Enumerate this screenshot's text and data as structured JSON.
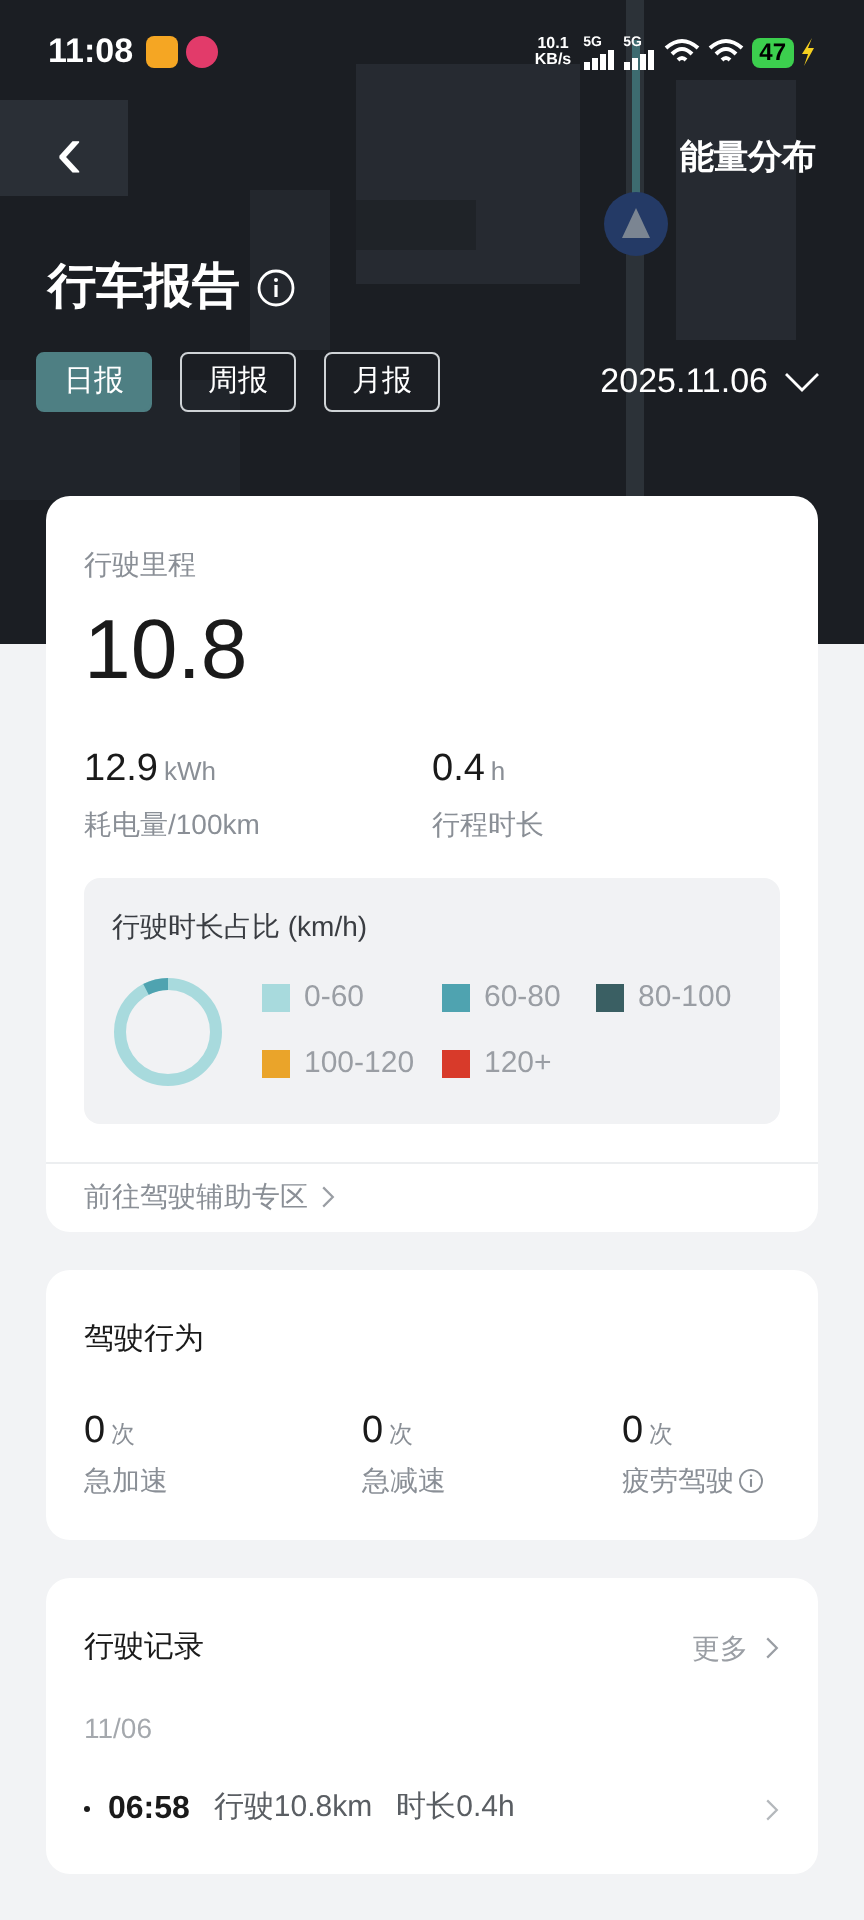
{
  "status_bar": {
    "time": "11:08",
    "net_speed": "10.1",
    "net_unit": "KB/s",
    "signals": [
      "5G",
      "5G"
    ],
    "battery": "47"
  },
  "header": {
    "back": "‹",
    "action": "能量分布",
    "title": "行车报告",
    "tabs": [
      {
        "label": "日报",
        "selected": true
      },
      {
        "label": "周报",
        "selected": false
      },
      {
        "label": "月报",
        "selected": false
      }
    ],
    "date": "2025.11.06"
  },
  "summary": {
    "label": "行驶里程",
    "distance": "10.8",
    "stats": [
      {
        "value": "12.9",
        "unit": "kWh",
        "label": "耗电量/100km"
      },
      {
        "value": "0.4",
        "unit": "h",
        "label": "行程时长"
      }
    ],
    "speed_share": {
      "title": "行驶时长占比 (km/h)",
      "legend": [
        {
          "label": "0-60",
          "color": "#a8dadd"
        },
        {
          "label": "60-80",
          "color": "#4fa3b0"
        },
        {
          "label": "80-100",
          "color": "#3a5f63"
        },
        {
          "label": "100-120",
          "color": "#eaa42a"
        },
        {
          "label": "120+",
          "color": "#d83a2a"
        }
      ]
    },
    "link": "前往驾驶辅助专区"
  },
  "behavior": {
    "title": "驾驶行为",
    "items": [
      {
        "value": "0",
        "unit": "次",
        "label": "急加速",
        "info": false
      },
      {
        "value": "0",
        "unit": "次",
        "label": "急减速",
        "info": false
      },
      {
        "value": "0",
        "unit": "次",
        "label": "疲劳驾驶",
        "info": true
      }
    ]
  },
  "records": {
    "title": "行驶记录",
    "more": "更多",
    "date": "11/06",
    "trips": [
      {
        "time": "06:58",
        "distance": "行驶10.8km",
        "duration": "时长0.4h"
      }
    ]
  }
}
